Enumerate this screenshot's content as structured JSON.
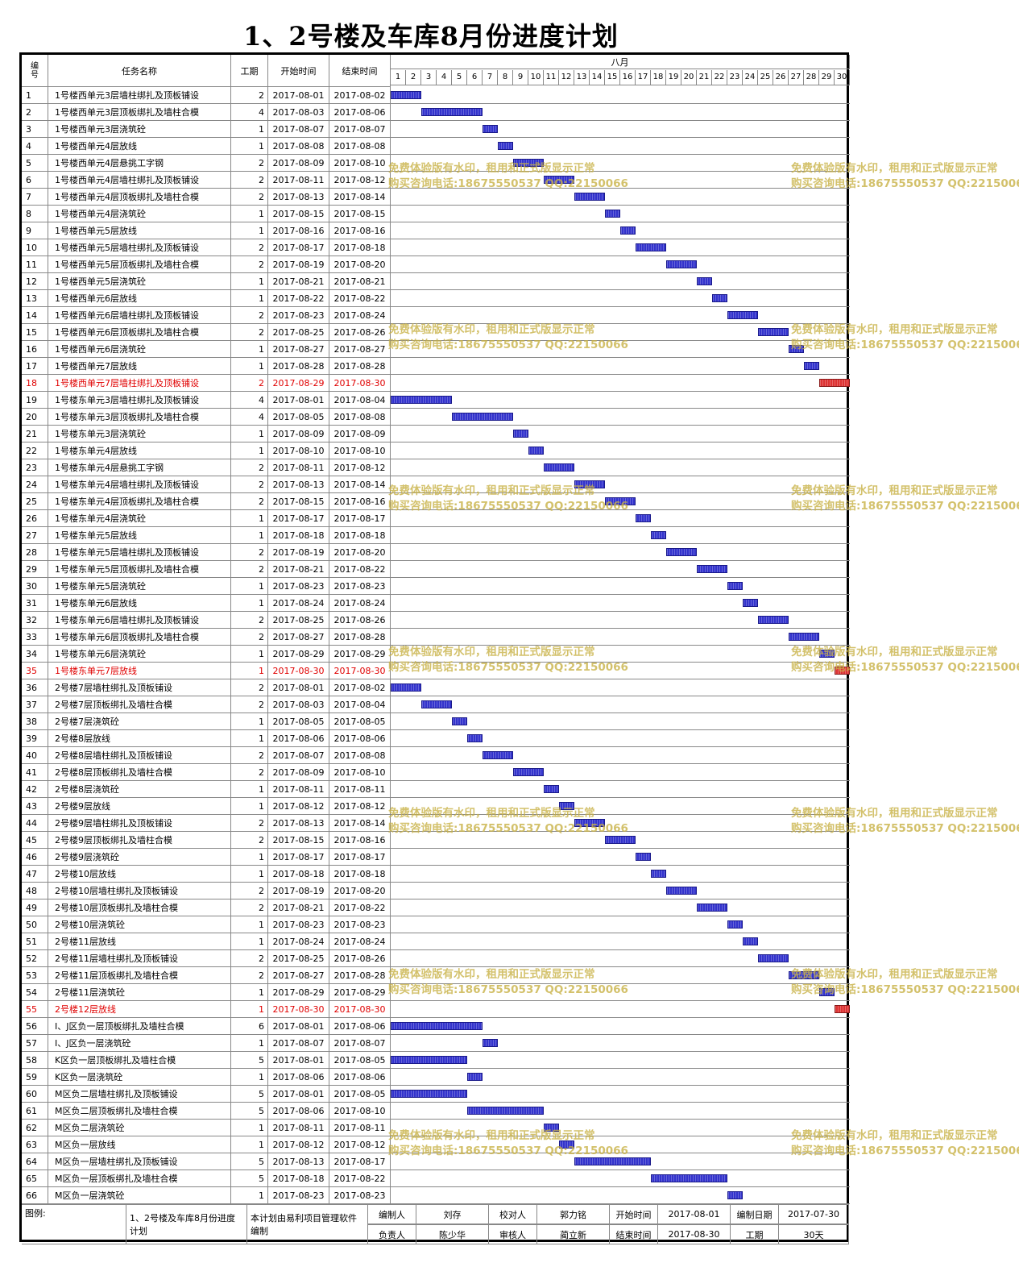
{
  "title": "1、2号楼及车库8月份进度计划",
  "header": {
    "num": "编号",
    "name": "任务名称",
    "dur": "工期",
    "start": "开始时间",
    "end": "结束时间",
    "month": "八月",
    "days": [
      "1",
      "2",
      "3",
      "4",
      "5",
      "6",
      "7",
      "8",
      "9",
      "10",
      "11",
      "12",
      "13",
      "14",
      "15",
      "16",
      "17",
      "18",
      "19",
      "20",
      "21",
      "22",
      "23",
      "24",
      "25",
      "26",
      "27",
      "28",
      "29",
      "30"
    ]
  },
  "colors": {
    "bar": "#3333cc",
    "critical": "#dd3333",
    "critical_text": "#e00000",
    "watermark": "#c8b246"
  },
  "tasks": [
    {
      "id": "1",
      "name": "1号楼西单元3层墙柱绑扎及顶板铺设",
      "dur": "2",
      "start": "2017-08-01",
      "end": "2017-08-02",
      "s": 1,
      "e": 2,
      "crit": false
    },
    {
      "id": "2",
      "name": "1号楼西单元3层顶板绑扎及墙柱合模",
      "dur": "4",
      "start": "2017-08-03",
      "end": "2017-08-06",
      "s": 3,
      "e": 6,
      "crit": false
    },
    {
      "id": "3",
      "name": "1号楼西单元3层浇筑砼",
      "dur": "1",
      "start": "2017-08-07",
      "end": "2017-08-07",
      "s": 7,
      "e": 7,
      "crit": false
    },
    {
      "id": "4",
      "name": "1号楼西单元4层放线",
      "dur": "1",
      "start": "2017-08-08",
      "end": "2017-08-08",
      "s": 8,
      "e": 8,
      "crit": false
    },
    {
      "id": "5",
      "name": "1号楼西单元4层悬挑工字钢",
      "dur": "2",
      "start": "2017-08-09",
      "end": "2017-08-10",
      "s": 9,
      "e": 10,
      "crit": false
    },
    {
      "id": "6",
      "name": "1号楼西单元4层墙柱绑扎及顶板铺设",
      "dur": "2",
      "start": "2017-08-11",
      "end": "2017-08-12",
      "s": 11,
      "e": 12,
      "crit": false
    },
    {
      "id": "7",
      "name": "1号楼西单元4层顶板绑扎及墙柱合模",
      "dur": "2",
      "start": "2017-08-13",
      "end": "2017-08-14",
      "s": 13,
      "e": 14,
      "crit": false
    },
    {
      "id": "8",
      "name": "1号楼西单元4层浇筑砼",
      "dur": "1",
      "start": "2017-08-15",
      "end": "2017-08-15",
      "s": 15,
      "e": 15,
      "crit": false
    },
    {
      "id": "9",
      "name": "1号楼西单元5层放线",
      "dur": "1",
      "start": "2017-08-16",
      "end": "2017-08-16",
      "s": 16,
      "e": 16,
      "crit": false
    },
    {
      "id": "10",
      "name": "1号楼西单元5层墙柱绑扎及顶板铺设",
      "dur": "2",
      "start": "2017-08-17",
      "end": "2017-08-18",
      "s": 17,
      "e": 18,
      "crit": false
    },
    {
      "id": "11",
      "name": "1号楼西单元5层顶板绑扎及墙柱合模",
      "dur": "2",
      "start": "2017-08-19",
      "end": "2017-08-20",
      "s": 19,
      "e": 20,
      "crit": false
    },
    {
      "id": "12",
      "name": "1号楼西单元5层浇筑砼",
      "dur": "1",
      "start": "2017-08-21",
      "end": "2017-08-21",
      "s": 21,
      "e": 21,
      "crit": false
    },
    {
      "id": "13",
      "name": "1号楼西单元6层放线",
      "dur": "1",
      "start": "2017-08-22",
      "end": "2017-08-22",
      "s": 22,
      "e": 22,
      "crit": false
    },
    {
      "id": "14",
      "name": "1号楼西单元6层墙柱绑扎及顶板铺设",
      "dur": "2",
      "start": "2017-08-23",
      "end": "2017-08-24",
      "s": 23,
      "e": 24,
      "crit": false
    },
    {
      "id": "15",
      "name": "1号楼西单元6层顶板绑扎及墙柱合模",
      "dur": "2",
      "start": "2017-08-25",
      "end": "2017-08-26",
      "s": 25,
      "e": 26,
      "crit": false
    },
    {
      "id": "16",
      "name": "1号楼西单元6层浇筑砼",
      "dur": "1",
      "start": "2017-08-27",
      "end": "2017-08-27",
      "s": 27,
      "e": 27,
      "crit": false
    },
    {
      "id": "17",
      "name": "1号楼西单元7层放线",
      "dur": "1",
      "start": "2017-08-28",
      "end": "2017-08-28",
      "s": 28,
      "e": 28,
      "crit": false
    },
    {
      "id": "18",
      "name": "1号楼西单元7层墙柱绑扎及顶板铺设",
      "dur": "2",
      "start": "2017-08-29",
      "end": "2017-08-30",
      "s": 29,
      "e": 30,
      "crit": true
    },
    {
      "id": "19",
      "name": "1号楼东单元3层墙柱绑扎及顶板铺设",
      "dur": "4",
      "start": "2017-08-01",
      "end": "2017-08-04",
      "s": 1,
      "e": 4,
      "crit": false
    },
    {
      "id": "20",
      "name": "1号楼东单元3层顶板绑扎及墙柱合模",
      "dur": "4",
      "start": "2017-08-05",
      "end": "2017-08-08",
      "s": 5,
      "e": 8,
      "crit": false
    },
    {
      "id": "21",
      "name": "1号楼东单元3层浇筑砼",
      "dur": "1",
      "start": "2017-08-09",
      "end": "2017-08-09",
      "s": 9,
      "e": 9,
      "crit": false
    },
    {
      "id": "22",
      "name": "1号楼东单元4层放线",
      "dur": "1",
      "start": "2017-08-10",
      "end": "2017-08-10",
      "s": 10,
      "e": 10,
      "crit": false
    },
    {
      "id": "23",
      "name": "1号楼东单元4层悬挑工字钢",
      "dur": "2",
      "start": "2017-08-11",
      "end": "2017-08-12",
      "s": 11,
      "e": 12,
      "crit": false
    },
    {
      "id": "24",
      "name": "1号楼东单元4层墙柱绑扎及顶板铺设",
      "dur": "2",
      "start": "2017-08-13",
      "end": "2017-08-14",
      "s": 13,
      "e": 14,
      "crit": false
    },
    {
      "id": "25",
      "name": "1号楼东单元4层顶板绑扎及墙柱合模",
      "dur": "2",
      "start": "2017-08-15",
      "end": "2017-08-16",
      "s": 15,
      "e": 16,
      "crit": false
    },
    {
      "id": "26",
      "name": "1号楼东单元4层浇筑砼",
      "dur": "1",
      "start": "2017-08-17",
      "end": "2017-08-17",
      "s": 17,
      "e": 17,
      "crit": false
    },
    {
      "id": "27",
      "name": "1号楼东单元5层放线",
      "dur": "1",
      "start": "2017-08-18",
      "end": "2017-08-18",
      "s": 18,
      "e": 18,
      "crit": false
    },
    {
      "id": "28",
      "name": "1号楼东单元5层墙柱绑扎及顶板铺设",
      "dur": "2",
      "start": "2017-08-19",
      "end": "2017-08-20",
      "s": 19,
      "e": 20,
      "crit": false
    },
    {
      "id": "29",
      "name": "1号楼东单元5层顶板绑扎及墙柱合模",
      "dur": "2",
      "start": "2017-08-21",
      "end": "2017-08-22",
      "s": 21,
      "e": 22,
      "crit": false
    },
    {
      "id": "30",
      "name": "1号楼东单元5层浇筑砼",
      "dur": "1",
      "start": "2017-08-23",
      "end": "2017-08-23",
      "s": 23,
      "e": 23,
      "crit": false
    },
    {
      "id": "31",
      "name": "1号楼东单元6层放线",
      "dur": "1",
      "start": "2017-08-24",
      "end": "2017-08-24",
      "s": 24,
      "e": 24,
      "crit": false
    },
    {
      "id": "32",
      "name": "1号楼东单元6层墙柱绑扎及顶板铺设",
      "dur": "2",
      "start": "2017-08-25",
      "end": "2017-08-26",
      "s": 25,
      "e": 26,
      "crit": false
    },
    {
      "id": "33",
      "name": "1号楼东单元6层顶板绑扎及墙柱合模",
      "dur": "2",
      "start": "2017-08-27",
      "end": "2017-08-28",
      "s": 27,
      "e": 28,
      "crit": false
    },
    {
      "id": "34",
      "name": "1号楼东单元6层浇筑砼",
      "dur": "1",
      "start": "2017-08-29",
      "end": "2017-08-29",
      "s": 29,
      "e": 29,
      "crit": false
    },
    {
      "id": "35",
      "name": "1号楼东单元7层放线",
      "dur": "1",
      "start": "2017-08-30",
      "end": "2017-08-30",
      "s": 30,
      "e": 30,
      "crit": true
    },
    {
      "id": "36",
      "name": "2号楼7层墙柱绑扎及顶板铺设",
      "dur": "2",
      "start": "2017-08-01",
      "end": "2017-08-02",
      "s": 1,
      "e": 2,
      "crit": false
    },
    {
      "id": "37",
      "name": "2号楼7层顶板绑扎及墙柱合模",
      "dur": "2",
      "start": "2017-08-03",
      "end": "2017-08-04",
      "s": 3,
      "e": 4,
      "crit": false
    },
    {
      "id": "38",
      "name": "2号楼7层浇筑砼",
      "dur": "1",
      "start": "2017-08-05",
      "end": "2017-08-05",
      "s": 5,
      "e": 5,
      "crit": false
    },
    {
      "id": "39",
      "name": "2号楼8层放线",
      "dur": "1",
      "start": "2017-08-06",
      "end": "2017-08-06",
      "s": 6,
      "e": 6,
      "crit": false
    },
    {
      "id": "40",
      "name": "2号楼8层墙柱绑扎及顶板铺设",
      "dur": "2",
      "start": "2017-08-07",
      "end": "2017-08-08",
      "s": 7,
      "e": 8,
      "crit": false
    },
    {
      "id": "41",
      "name": "2号楼8层顶板绑扎及墙柱合模",
      "dur": "2",
      "start": "2017-08-09",
      "end": "2017-08-10",
      "s": 9,
      "e": 10,
      "crit": false
    },
    {
      "id": "42",
      "name": "2号楼8层浇筑砼",
      "dur": "1",
      "start": "2017-08-11",
      "end": "2017-08-11",
      "s": 11,
      "e": 11,
      "crit": false
    },
    {
      "id": "43",
      "name": "2号楼9层放线",
      "dur": "1",
      "start": "2017-08-12",
      "end": "2017-08-12",
      "s": 12,
      "e": 12,
      "crit": false
    },
    {
      "id": "44",
      "name": "2号楼9层墙柱绑扎及顶板铺设",
      "dur": "2",
      "start": "2017-08-13",
      "end": "2017-08-14",
      "s": 13,
      "e": 14,
      "crit": false
    },
    {
      "id": "45",
      "name": "2号楼9层顶板绑扎及墙柱合模",
      "dur": "2",
      "start": "2017-08-15",
      "end": "2017-08-16",
      "s": 15,
      "e": 16,
      "crit": false
    },
    {
      "id": "46",
      "name": "2号楼9层浇筑砼",
      "dur": "1",
      "start": "2017-08-17",
      "end": "2017-08-17",
      "s": 17,
      "e": 17,
      "crit": false
    },
    {
      "id": "47",
      "name": "2号楼10层放线",
      "dur": "1",
      "start": "2017-08-18",
      "end": "2017-08-18",
      "s": 18,
      "e": 18,
      "crit": false
    },
    {
      "id": "48",
      "name": "2号楼10层墙柱绑扎及顶板铺设",
      "dur": "2",
      "start": "2017-08-19",
      "end": "2017-08-20",
      "s": 19,
      "e": 20,
      "crit": false
    },
    {
      "id": "49",
      "name": "2号楼10层顶板绑扎及墙柱合模",
      "dur": "2",
      "start": "2017-08-21",
      "end": "2017-08-22",
      "s": 21,
      "e": 22,
      "crit": false
    },
    {
      "id": "50",
      "name": "2号楼10层浇筑砼",
      "dur": "1",
      "start": "2017-08-23",
      "end": "2017-08-23",
      "s": 23,
      "e": 23,
      "crit": false
    },
    {
      "id": "51",
      "name": "2号楼11层放线",
      "dur": "1",
      "start": "2017-08-24",
      "end": "2017-08-24",
      "s": 24,
      "e": 24,
      "crit": false
    },
    {
      "id": "52",
      "name": "2号楼11层墙柱绑扎及顶板铺设",
      "dur": "2",
      "start": "2017-08-25",
      "end": "2017-08-26",
      "s": 25,
      "e": 26,
      "crit": false
    },
    {
      "id": "53",
      "name": "2号楼11层顶板绑扎及墙柱合模",
      "dur": "2",
      "start": "2017-08-27",
      "end": "2017-08-28",
      "s": 27,
      "e": 28,
      "crit": false
    },
    {
      "id": "54",
      "name": "2号楼11层浇筑砼",
      "dur": "1",
      "start": "2017-08-29",
      "end": "2017-08-29",
      "s": 29,
      "e": 29,
      "crit": false
    },
    {
      "id": "55",
      "name": "2号楼12层放线",
      "dur": "1",
      "start": "2017-08-30",
      "end": "2017-08-30",
      "s": 30,
      "e": 30,
      "crit": true
    },
    {
      "id": "56",
      "name": "I、J区负一层顶板绑扎及墙柱合模",
      "dur": "6",
      "start": "2017-08-01",
      "end": "2017-08-06",
      "s": 1,
      "e": 6,
      "crit": false
    },
    {
      "id": "57",
      "name": "I、J区负一层浇筑砼",
      "dur": "1",
      "start": "2017-08-07",
      "end": "2017-08-07",
      "s": 7,
      "e": 7,
      "crit": false
    },
    {
      "id": "58",
      "name": "K区负一层顶板绑扎及墙柱合模",
      "dur": "5",
      "start": "2017-08-01",
      "end": "2017-08-05",
      "s": 1,
      "e": 5,
      "crit": false
    },
    {
      "id": "59",
      "name": "K区负一层浇筑砼",
      "dur": "1",
      "start": "2017-08-06",
      "end": "2017-08-06",
      "s": 6,
      "e": 6,
      "crit": false
    },
    {
      "id": "60",
      "name": "M区负二层墙柱绑扎及顶板铺设",
      "dur": "5",
      "start": "2017-08-01",
      "end": "2017-08-05",
      "s": 1,
      "e": 5,
      "crit": false
    },
    {
      "id": "61",
      "name": "M区负二层顶板绑扎及墙柱合模",
      "dur": "5",
      "start": "2017-08-06",
      "end": "2017-08-10",
      "s": 6,
      "e": 10,
      "crit": false
    },
    {
      "id": "62",
      "name": "M区负二层浇筑砼",
      "dur": "1",
      "start": "2017-08-11",
      "end": "2017-08-11",
      "s": 11,
      "e": 11,
      "crit": false
    },
    {
      "id": "63",
      "name": "M区负一层放线",
      "dur": "1",
      "start": "2017-08-12",
      "end": "2017-08-12",
      "s": 12,
      "e": 12,
      "crit": false
    },
    {
      "id": "64",
      "name": "M区负一层墙柱绑扎及顶板铺设",
      "dur": "5",
      "start": "2017-08-13",
      "end": "2017-08-17",
      "s": 13,
      "e": 17,
      "crit": false
    },
    {
      "id": "65",
      "name": "M区负一层顶板绑扎及墙柱合模",
      "dur": "5",
      "start": "2017-08-18",
      "end": "2017-08-22",
      "s": 18,
      "e": 22,
      "crit": false
    },
    {
      "id": "66",
      "name": "M区负一层浇筑砼",
      "dur": "1",
      "start": "2017-08-23",
      "end": "2017-08-23",
      "s": 23,
      "e": 23,
      "crit": false
    }
  ],
  "footer": {
    "legend": "图例:",
    "plan_name": "1、2号楼及车库8月份进度计划",
    "software": "本计划由易利项目管理软件编制",
    "compiler_label": "编制人",
    "compiler": "刘存",
    "proofreader_label": "校对人",
    "proofreader": "郭力铭",
    "start_label": "开始时间",
    "start": "2017-08-01",
    "date_label": "编制日期",
    "date": "2017-07-30",
    "owner_label": "负责人",
    "owner": "陈少华",
    "reviewer_label": "审核人",
    "reviewer": "蔺立新",
    "end_label": "结束时间",
    "end": "2017-08-30",
    "dur_label": "工期",
    "dur": "30天"
  },
  "watermark": {
    "line1": "免费体验版有水印，租用和正式版显示正常",
    "line2": "购买咨询电话:18675550537 QQ:22150066"
  }
}
